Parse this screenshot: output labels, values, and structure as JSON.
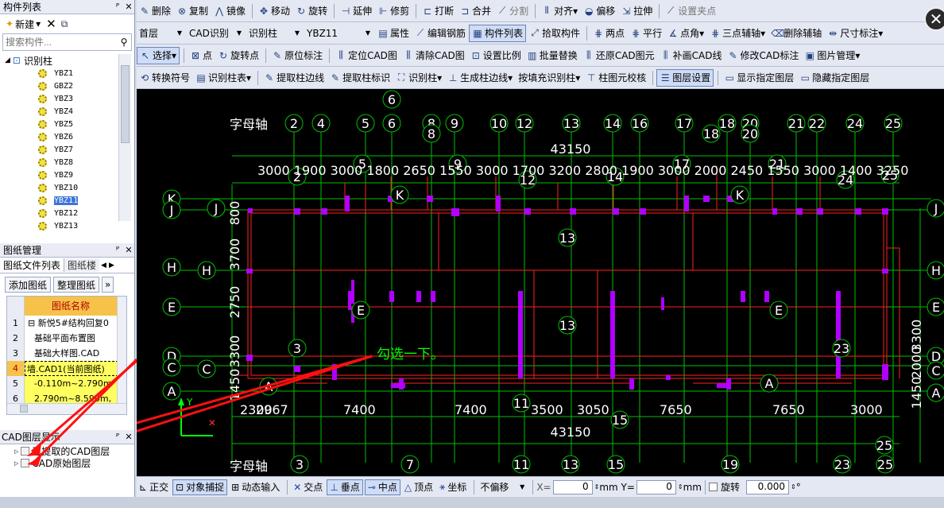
{
  "component_list": {
    "title": "构件列表",
    "new_label": "新建",
    "search_placeholder": "搜索构件...",
    "root": "识别柱",
    "items": [
      "YBZ1",
      "GBZ2",
      "YBZ3",
      "YBZ4",
      "YBZ5",
      "YBZ6",
      "YBZ7",
      "YBZ8",
      "YBZ9",
      "YBZ10",
      "YBZ11",
      "YBZ12",
      "YBZ13"
    ],
    "selected": "YBZ11"
  },
  "drawing_mgmt": {
    "title": "图纸管理",
    "tabs": [
      "图纸文件列表",
      "图纸楼"
    ],
    "add_label": "添加图纸",
    "organize_label": "整理图纸",
    "col_header": "图纸名称",
    "rows": [
      {
        "no": "1",
        "name": "新悦5#结构回复0"
      },
      {
        "no": "2",
        "name": "基础平面布置图"
      },
      {
        "no": "3",
        "name": "基础大样图.CAD"
      },
      {
        "no": "4",
        "name": "墙.CAD1(当前图纸)"
      },
      {
        "no": "5",
        "name": "-0.110m~2.790m"
      },
      {
        "no": "6",
        "name": "2.790m~8.590m,"
      }
    ]
  },
  "cad_layers": {
    "title": "CAD图层显示",
    "items": [
      "已提取的CAD图层",
      "CAD原始图层"
    ]
  },
  "toolbar1": [
    "删除",
    "复制",
    "镜像",
    "移动",
    "旋转",
    "延伸",
    "修剪",
    "打断",
    "合并",
    "分割",
    "对齐",
    "偏移",
    "拉伸",
    "设置夹点"
  ],
  "toolbar2": {
    "floor": "首层",
    "cad": "CAD识别",
    "type": "识别柱",
    "comp": "YBZ11",
    "items": [
      "属性",
      "编辑钢筋",
      "构件列表",
      "拾取构件",
      "两点",
      "平行",
      "点角",
      "三点辅轴",
      "删除辅轴",
      "尺寸标注"
    ]
  },
  "toolbar3": [
    "选择",
    "点",
    "旋转点",
    "原位标注",
    "定位CAD图",
    "清除CAD图",
    "设置比例",
    "批量替换",
    "还原CAD图元",
    "补画CAD线",
    "修改CAD标注",
    "图片管理"
  ],
  "toolbar4": [
    "转换符号",
    "识别柱表",
    "提取柱边线",
    "提取柱标识",
    "识别柱",
    "生成柱边线",
    "按填充识别柱",
    "柱图元校核",
    "图层设置",
    "显示指定图层",
    "隐藏指定图层"
  ],
  "canvas": {
    "annotation": "勾选一下。",
    "axis_label_top": "字母轴",
    "axis_label_bottom": "字母轴",
    "total_dim_top": "43150",
    "total_dim_bottom": "43150",
    "top_dims": "3000 1900 3000 1800 2650 1550 3000 1700 3200   2800 1900 3000 2000 2450 1550 3000 1400 3250",
    "bottom_dims": [
      "2300",
      "2967",
      "7400",
      "7400",
      "3500",
      "3050",
      "7650",
      "7650",
      "3000"
    ],
    "left_dims": [
      "800",
      "3700",
      "2750",
      "3300",
      "1450"
    ],
    "right_dims": [
      "3300",
      "2000",
      "1450"
    ],
    "top_axes": [
      "2",
      "4",
      "5",
      "6",
      "8",
      "9",
      "10",
      "12",
      "13",
      "14",
      "16",
      "17",
      "18",
      "20",
      "21",
      "22",
      "24",
      "25"
    ],
    "top_axes_second": [
      "6",
      "8",
      "18",
      "20"
    ],
    "mid_axes": [
      "5",
      "2",
      "9",
      "12",
      "14",
      "17",
      "21",
      "24",
      "25"
    ],
    "bottom_axes": [
      "3",
      "7",
      "11",
      "13",
      "15",
      "19",
      "23",
      "25"
    ],
    "row_axes_left": [
      "K",
      "J",
      "H",
      "E",
      "D",
      "C",
      "A"
    ],
    "row_axes_right": [
      "J",
      "H",
      "E",
      "D",
      "C",
      "A"
    ],
    "inner_labels": [
      "K",
      "K",
      "J",
      "H",
      "E",
      "E",
      "A",
      "A",
      "C",
      "3",
      "23",
      "13",
      "13",
      "11",
      "15",
      "25"
    ]
  },
  "status": {
    "items": [
      "正交",
      "对象捕捉",
      "动态输入",
      "交点",
      "垂点",
      "中点",
      "顶点",
      "坐标"
    ],
    "offset": "不偏移",
    "x_label": "X=",
    "x_val": "0",
    "y_label": "mm Y=",
    "y_val": "0",
    "unit": "mm",
    "rotate": "旋转",
    "rotate_val": "0.000",
    "deg": "°"
  }
}
